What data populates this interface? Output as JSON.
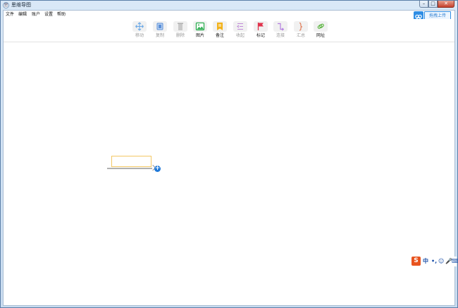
{
  "window": {
    "title": "思维导图",
    "app_icon": "思",
    "controls": {
      "minimize": "–",
      "maximize": "□",
      "close": "✕"
    }
  },
  "menu": [
    "文件",
    "编辑",
    "账户",
    "设置",
    "帮助"
  ],
  "cloud_button": {
    "label": "拖拽上传",
    "icon": "cloud-icon"
  },
  "toolbar": {
    "tools": [
      {
        "label": "移动",
        "icon": "move-icon",
        "enabled": false,
        "color": "#6aa8e6"
      },
      {
        "label": "复制",
        "icon": "copy-icon",
        "enabled": false,
        "color": "#5a8fd8"
      },
      {
        "label": "删除",
        "icon": "trash-icon",
        "enabled": false,
        "color": "#b9b9b9"
      },
      {
        "label": "图片",
        "icon": "image-icon",
        "enabled": true,
        "color": "#2eae51"
      },
      {
        "label": "备注",
        "icon": "note-icon",
        "enabled": true,
        "color": "#f2b21a"
      },
      {
        "label": "收起",
        "icon": "collapse-icon",
        "enabled": false,
        "color": "#c08ad8"
      },
      {
        "label": "标记",
        "icon": "flag-icon",
        "enabled": true,
        "color": "#e0334c"
      },
      {
        "label": "连接",
        "icon": "connect-icon",
        "enabled": false,
        "color": "#b37ee0"
      },
      {
        "label": "汇总",
        "icon": "summary-icon",
        "enabled": false,
        "color": "#e07a55"
      },
      {
        "label": "网址",
        "icon": "link-icon",
        "enabled": true,
        "color": "#58b43d"
      }
    ]
  },
  "canvas": {
    "node_text": "",
    "add_child": "+"
  },
  "ime": {
    "logo": "S",
    "items": [
      "中",
      "•,",
      "☺",
      "🎤",
      "⌨"
    ]
  }
}
